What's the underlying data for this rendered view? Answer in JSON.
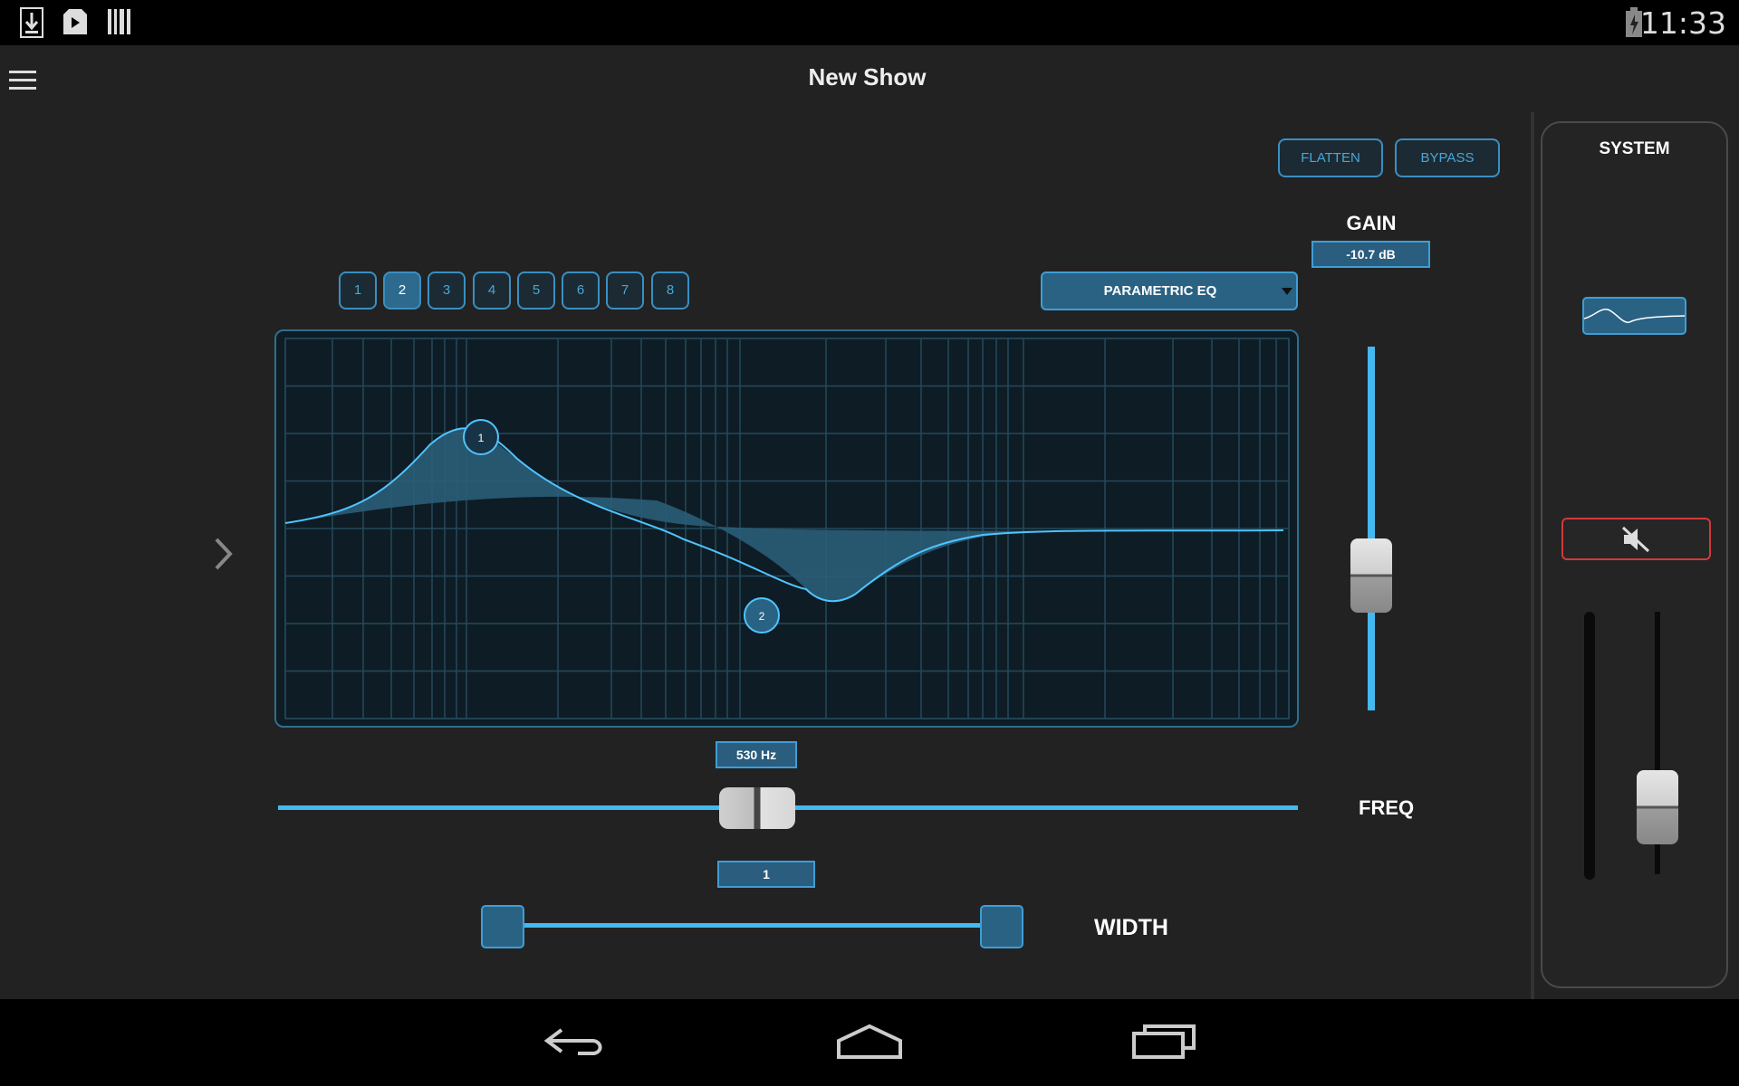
{
  "status_bar": {
    "time": "11:33",
    "icons": [
      "download-icon",
      "play-store-icon",
      "barcode-icon",
      "battery-icon"
    ]
  },
  "app_bar": {
    "title": "New Show",
    "menu_icon": "hamburger-menu-icon"
  },
  "eq": {
    "buttons": {
      "flatten": "FLATTEN",
      "bypass": "BYPASS"
    },
    "bands": [
      "1",
      "2",
      "3",
      "4",
      "5",
      "6",
      "7",
      "8"
    ],
    "active_band": "2",
    "eq_type": "PARAMETRIC EQ",
    "gain": {
      "label": "GAIN",
      "value": "-10.7 dB",
      "level": 0.37
    },
    "freq": {
      "label": "FREQ",
      "value": "530 Hz",
      "level": 0.47
    },
    "width": {
      "label": "WIDTH",
      "value": "1",
      "low_level": 0.22,
      "high_level": 0.71
    },
    "graph_nodes": [
      {
        "label": "1"
      },
      {
        "label": "2"
      }
    ],
    "expand_icon": "chevron-right-icon"
  },
  "system_panel": {
    "title": "SYSTEM",
    "eq_thumb_icon": "eq-curve-icon",
    "mute_icon": "speaker-muted-icon",
    "fader_level": 0.22
  },
  "nav_bar": {
    "icons": [
      "back-icon",
      "home-icon",
      "recents-icon"
    ]
  },
  "colors": {
    "accent": "#44b8f0",
    "mute_border": "#d03a3a",
    "background": "#222222"
  }
}
